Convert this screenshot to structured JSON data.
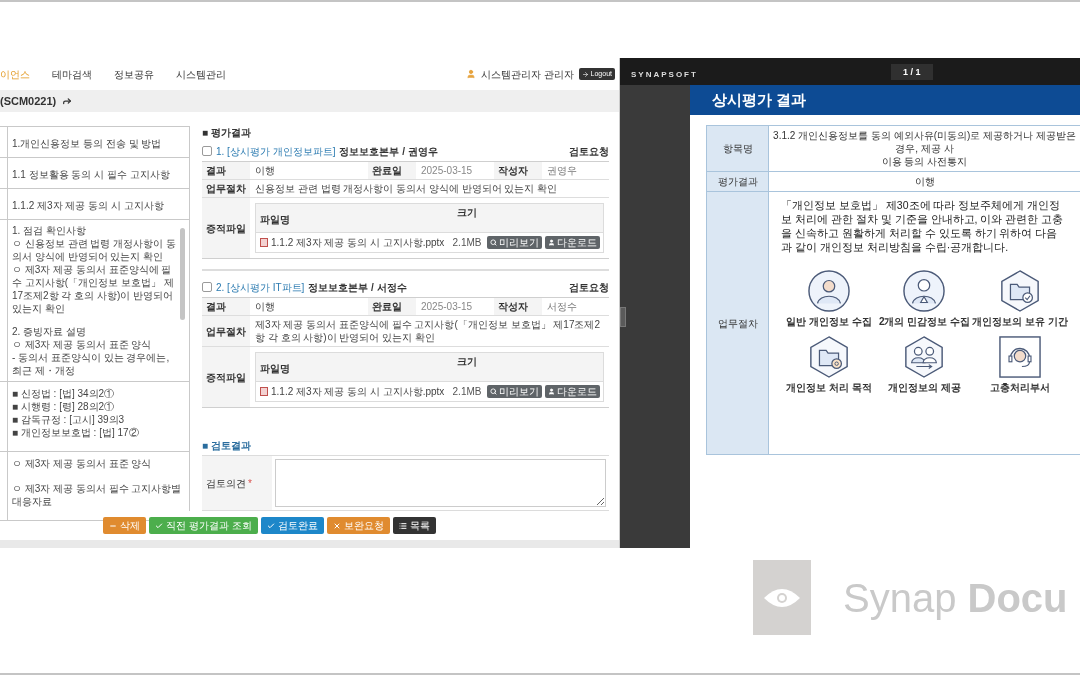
{
  "nav": {
    "items": [
      {
        "label": "이언스",
        "selected": true
      },
      {
        "label": "테마검색",
        "selected": false
      },
      {
        "label": "정보공유",
        "selected": false
      },
      {
        "label": "시스템관리",
        "selected": false
      }
    ],
    "user": "시스템관리자 관리자",
    "logout": "Logout"
  },
  "title_bar": {
    "title": "(SCM0221)"
  },
  "checklist": [
    {
      "kind": "line",
      "text": "1.개인신용정보 등의 전송 및 방법"
    },
    {
      "kind": "line",
      "text": "1.1 정보활용 동의 시 필수 고지사항"
    },
    {
      "kind": "line",
      "text": "1.1.2 제3자 제공 동의 시 고지사항"
    },
    {
      "kind": "scroll",
      "groups": [
        [
          "1. 점검 확인사항",
          "ㅇ 신용정보 관련 법령 개정사항이 동의서 양식에 반영되어 있는지 확인",
          "ㅇ 제3자 제공 동의서 표준양식에 필수 고지사항(「개인정보 보호법」 제17조제2항 각 호의 사항)이 반영되어 있는지 확인"
        ],
        [
          "2. 증빙자료 설명",
          "ㅇ 제3자 제공 동의서 표준 양식",
          "- 동의서 표준양식이 있는 경우에는, 최근 제・개정"
        ]
      ]
    },
    {
      "kind": "list",
      "groups": [
        [
          "■ 신정법 : [법] 34의2①",
          "■ 시행령 : [령] 28의2①",
          "■ 감독규정 : [고시] 39의3",
          "■ 개인정보보호법 : [법] 17②"
        ]
      ]
    },
    {
      "kind": "list",
      "groups": [
        [
          "ㅇ 제3자 제공 동의서 표준 양식"
        ],
        [
          "ㅇ 제3자 제공 동의서 필수 고지사항별 대응자료"
        ]
      ]
    }
  ],
  "evaluation": {
    "title": "■ 평가결과",
    "items": [
      {
        "checked": false,
        "link": "1. [상시평가 개인정보파트]",
        "owner": "정보보호본부 / 권영우",
        "status": "검토요청",
        "result_label": "결과",
        "result": "이행",
        "date_label": "완료일",
        "date": "2025-03-15",
        "author_label": "작성자",
        "author": "권영우",
        "procedure_label": "업무절차",
        "procedure": "신용정보 관련 법령 개정사항이 동의서 양식에 반영되어 있는지 확인",
        "files_label": "증적파일",
        "file_columns": [
          "파일명",
          "크기"
        ],
        "files": [
          {
            "name": "1.1.2 제3자 제공 동의 시 고지사항.pptx",
            "size": "2.1MB",
            "preview": "미리보기",
            "download": "다운로드"
          }
        ]
      },
      {
        "checked": false,
        "link": "2. [상시평가 IT파트]",
        "owner": "정보보호본부 / 서정수",
        "status": "검토요청",
        "result_label": "결과",
        "result": "이행",
        "date_label": "완료일",
        "date": "2025-03-15",
        "author_label": "작성자",
        "author": "서정수",
        "procedure_label": "업무절차",
        "procedure": "제3자 제공 동의서 표준양식에 필수 고지사항(「개인정보 보호법」 제17조제2항 각 호의 사항)이 반영되어 있는지 확인",
        "files_label": "증적파일",
        "file_columns": [
          "파일명",
          "크기"
        ],
        "files": [
          {
            "name": "1.1.2 제3자 제공 동의 시 고지사항.pptx",
            "size": "2.1MB",
            "preview": "미리보기",
            "download": "다운로드"
          }
        ]
      }
    ]
  },
  "review": {
    "title": "■ 검토결과",
    "label": "검토의견",
    "required_mark": "*"
  },
  "buttons": [
    {
      "label": "삭제",
      "kind": "minus",
      "color": "#e08b2f"
    },
    {
      "label": "직전 평가결과 조회",
      "kind": "check",
      "color": "#4cae4c"
    },
    {
      "label": "검토완료",
      "kind": "check",
      "color": "#1d87c9"
    },
    {
      "label": "보완요청",
      "kind": "cross",
      "color": "#e08b2f"
    },
    {
      "label": "목록",
      "kind": "list",
      "color": "#333333"
    }
  ],
  "viewer": {
    "brand": "SYNAPSOFT",
    "page": "1 / 1",
    "document": {
      "title": "상시평가 결과",
      "rows": [
        {
          "kind": "lines",
          "label": "항목명",
          "lines": [
            "3.1.2 개인신용정보를 동의 예외사유(미동의)로 제공하거나 제공받은 경우, 제공 사",
            "이용 등의 사전통지"
          ]
        },
        {
          "kind": "value",
          "label": "평가결과",
          "value": "이행"
        },
        {
          "kind": "procedure",
          "label": "업무절차",
          "paragraph": "「개인정보 보호법」 제30조에 따라 정보주체에게 개인정보 처리에 관한 절차 및 기준을 안내하고, 이와 관련한 고충을 신속하고 원활하게 처리할 수 있도록 하기 위하여 다음과 같이 개인정보 처리방침을 수립·공개합니다.",
          "icons": [
            {
              "kind": "person",
              "label": "일반 개인정보 수집"
            },
            {
              "kind": "personmark",
              "label": "2개의 민감정보 수집"
            },
            {
              "kind": "folderclock",
              "label": "개인정보의 보유 기간"
            },
            {
              "kind": "foldergear",
              "label": "개인정보 처리 목적"
            },
            {
              "kind": "people",
              "label": "개인정보의 제공"
            },
            {
              "kind": "headset",
              "label": "고충처리부서"
            }
          ]
        }
      ]
    }
  },
  "logo": {
    "text": "Synap **Docu**"
  }
}
